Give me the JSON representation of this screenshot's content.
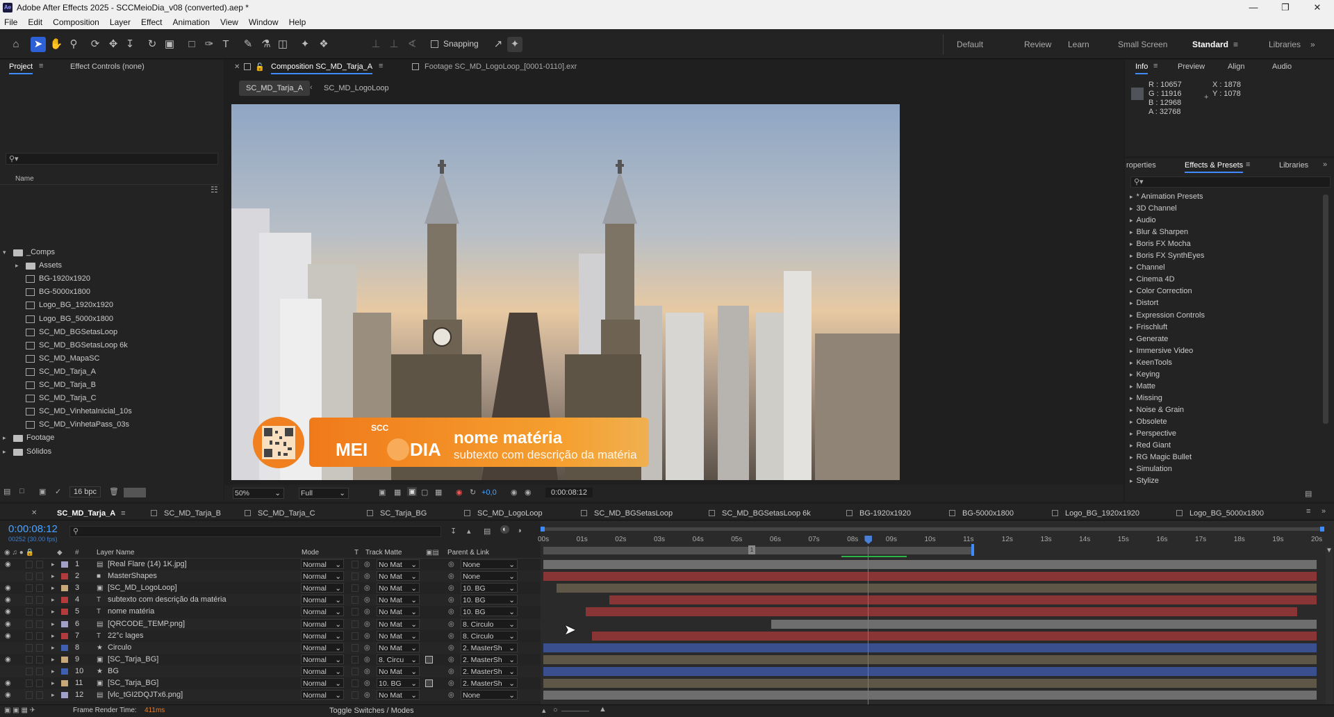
{
  "app": {
    "title": "Adobe After Effects 2025 - SCCMeioDia_v08 (converted).aep *",
    "logo_text": "Ae"
  },
  "menu": [
    "File",
    "Edit",
    "Composition",
    "Layer",
    "Effect",
    "Animation",
    "View",
    "Window",
    "Help"
  ],
  "toolbar": {
    "snapping_label": "Snapping",
    "workspaces": [
      "Default",
      "Review",
      "Learn",
      "Small Screen",
      "Standard",
      "Libraries"
    ],
    "active_workspace": "Standard"
  },
  "project_panel": {
    "tab_project": "Project",
    "tab_effect_controls": "Effect Controls (none)",
    "search_placeholder": "",
    "col_name": "Name",
    "items": [
      {
        "name": "_Comps",
        "type": "folder",
        "indent": 0,
        "expanded": true
      },
      {
        "name": "Assets",
        "type": "folder",
        "indent": 1,
        "expanded": false
      },
      {
        "name": "BG-1920x1920",
        "type": "comp",
        "indent": 2
      },
      {
        "name": "BG-5000x1800",
        "type": "comp",
        "indent": 2
      },
      {
        "name": "Logo_BG_1920x1920",
        "type": "comp",
        "indent": 2
      },
      {
        "name": "Logo_BG_5000x1800",
        "type": "comp",
        "indent": 2
      },
      {
        "name": "SC_MD_BGSetasLoop",
        "type": "comp",
        "indent": 2
      },
      {
        "name": "SC_MD_BGSetasLoop 6k",
        "type": "comp",
        "indent": 2
      },
      {
        "name": "SC_MD_MapaSC",
        "type": "comp",
        "indent": 2
      },
      {
        "name": "SC_MD_Tarja_A",
        "type": "comp",
        "indent": 2
      },
      {
        "name": "SC_MD_Tarja_B",
        "type": "comp",
        "indent": 2
      },
      {
        "name": "SC_MD_Tarja_C",
        "type": "comp",
        "indent": 2
      },
      {
        "name": "SC_MD_VinhetaInicial_10s",
        "type": "comp",
        "indent": 2
      },
      {
        "name": "SC_MD_VinhetaPass_03s",
        "type": "comp",
        "indent": 2
      },
      {
        "name": "Footage",
        "type": "folder",
        "indent": 0,
        "expanded": false
      },
      {
        "name": "Sólidos",
        "type": "folder",
        "indent": 0,
        "expanded": false
      }
    ],
    "bpc": "16 bpc"
  },
  "comp_panel": {
    "tab_comp": "Composition SC_MD_Tarja_A",
    "tab_footage": "Footage SC_MD_LogoLoop_[0001-0110].exr",
    "breadcrumb": [
      "SC_MD_Tarja_A",
      "SC_MD_LogoLoop"
    ],
    "zoom": "50%",
    "resolution": "Full",
    "exposure": "+0,0",
    "timecode": "0:00:08:12",
    "overlay": {
      "brand_small": "SCC",
      "brand_left": "MEI",
      "brand_right": "DIA",
      "headline": "nome matéria",
      "subline": "subtexto com descrição da matéria"
    }
  },
  "info_panel": {
    "tabs": [
      "Info",
      "Preview",
      "Align",
      "Audio"
    ],
    "r": "R : 10657",
    "g": "G : 11916",
    "b": "B : 12968",
    "a": "A : 32768",
    "x": "X : 1878",
    "y": "Y : 1078"
  },
  "effects_panel": {
    "tabs": [
      "roperties",
      "Effects & Presets",
      "Libraries"
    ],
    "items": [
      "* Animation Presets",
      "3D Channel",
      "Audio",
      "Blur & Sharpen",
      "Boris FX Mocha",
      "Boris FX SynthEyes",
      "Channel",
      "Cinema 4D",
      "Color Correction",
      "Distort",
      "Expression Controls",
      "Frischluft",
      "Generate",
      "Immersive Video",
      "KeenTools",
      "Keying",
      "Matte",
      "Missing",
      "Noise & Grain",
      "Obsolete",
      "Perspective",
      "Red Giant",
      "RG Magic Bullet",
      "Simulation",
      "Stylize"
    ]
  },
  "timeline": {
    "tabs": [
      "SC_MD_Tarja_A",
      "SC_MD_Tarja_B",
      "SC_MD_Tarja_C",
      "SC_Tarja_BG",
      "SC_MD_LogoLoop",
      "SC_MD_BGSetasLoop",
      "SC_MD_BGSetasLoop 6k",
      "BG-1920x1920",
      "BG-5000x1800",
      "Logo_BG_1920x1920",
      "Logo_BG_5000x1800"
    ],
    "timecode": "0:00:08:12",
    "frame_info": "00252 (30.00 fps)",
    "headers": {
      "layer_name": "Layer Name",
      "mode": "Mode",
      "t": "T",
      "track_matte": "Track Matte",
      "parent": "Parent & Link"
    },
    "ruler": [
      "00s",
      "01s",
      "02s",
      "03s",
      "04s",
      "05s",
      "06s",
      "07s",
      "08s",
      "09s",
      "10s",
      "11s",
      "12s",
      "13s",
      "14s",
      "15s",
      "16s",
      "17s",
      "18s",
      "19s",
      "20s"
    ],
    "layers": [
      {
        "num": "1",
        "name": "[Real Flare (14) 1K.jpg]",
        "type": "footage",
        "label_color": "#a0a0c8",
        "mode": "Normal",
        "matte": "No Mat",
        "parent": "None",
        "bar_color": "#6e6e6e",
        "start": 0.0,
        "end": 20.0
      },
      {
        "num": "2",
        "name": "MasterShapes",
        "type": "solid",
        "label_color": "#b33b3b",
        "mode": "Normal",
        "matte": "No Mat",
        "parent": "None",
        "bar_color": "#8a3535",
        "start": 0.0,
        "end": 20.0
      },
      {
        "num": "3",
        "name": "[SC_MD_LogoLoop]",
        "type": "comp",
        "label_color": "#c8a878",
        "mode": "Normal",
        "matte": "No Mat",
        "parent": "10. BG",
        "bar_color": "#5e5748",
        "start": 0.35,
        "end": 20.0
      },
      {
        "num": "4",
        "name": "subtexto com descrição da matéria",
        "type": "text",
        "label_color": "#b33b3b",
        "mode": "Normal",
        "matte": "No Mat",
        "parent": "10. BG",
        "bar_color": "#8a3535",
        "start": 1.7,
        "end": 20.0
      },
      {
        "num": "5",
        "name": "nome matéria",
        "type": "text",
        "label_color": "#b33b3b",
        "mode": "Normal",
        "matte": "No Mat",
        "parent": "10. BG",
        "bar_color": "#8a3535",
        "start": 1.1,
        "end": 19.5
      },
      {
        "num": "6",
        "name": "[QRCODE_TEMP.png]",
        "type": "footage",
        "label_color": "#a0a0c8",
        "mode": "Normal",
        "matte": "No Mat",
        "parent": "8. Circulo",
        "bar_color": "#6e6e6e",
        "start": 5.9,
        "end": 20.0
      },
      {
        "num": "7",
        "name": "22°c lages",
        "type": "text",
        "label_color": "#b33b3b",
        "mode": "Normal",
        "matte": "No Mat",
        "parent": "8. Circulo",
        "bar_color": "#8a3535",
        "start": 1.25,
        "end": 20.0
      },
      {
        "num": "8",
        "name": "Circulo",
        "type": "shape",
        "label_color": "#3f5fb0",
        "mode": "Normal",
        "matte": "No Mat",
        "parent": "2. MasterSh",
        "bar_color": "#3a508e",
        "start": 0.0,
        "end": 20.0
      },
      {
        "num": "9",
        "name": "[SC_Tarja_BG]",
        "type": "comp",
        "label_color": "#c8a878",
        "mode": "Normal",
        "matte": "8. Circu",
        "parent": "2. MasterSh",
        "bar_color": "#5e5748",
        "start": 0.0,
        "end": 20.0
      },
      {
        "num": "10",
        "name": "BG",
        "type": "shape",
        "label_color": "#3f5fb0",
        "mode": "Normal",
        "matte": "No Mat",
        "parent": "2. MasterSh",
        "bar_color": "#3a508e",
        "start": 0.0,
        "end": 20.0
      },
      {
        "num": "11",
        "name": "[SC_Tarja_BG]",
        "type": "comp",
        "label_color": "#c8a878",
        "mode": "Normal",
        "matte": "10. BG",
        "parent": "2. MasterSh",
        "bar_color": "#5e5748",
        "start": 0.0,
        "end": 20.0
      },
      {
        "num": "12",
        "name": "[vlc_tGI2DQJTx6.png]",
        "type": "footage",
        "label_color": "#a0a0c8",
        "mode": "Normal",
        "matte": "No Mat",
        "parent": "None",
        "bar_color": "#6e6e6e",
        "start": 0.0,
        "end": 20.0
      }
    ],
    "current_time_sec": 8.4,
    "work_area": {
      "start": 0.0,
      "end": 11.1
    },
    "render_label": "Frame Render Time:",
    "render_value": "411ms",
    "toggle_label": "Toggle Switches / Modes"
  },
  "colors": {
    "accent": "#3d8bff",
    "timecode": "#4aa3ff",
    "playhead": "#4a7fd8",
    "orange": "#f07a1a"
  }
}
